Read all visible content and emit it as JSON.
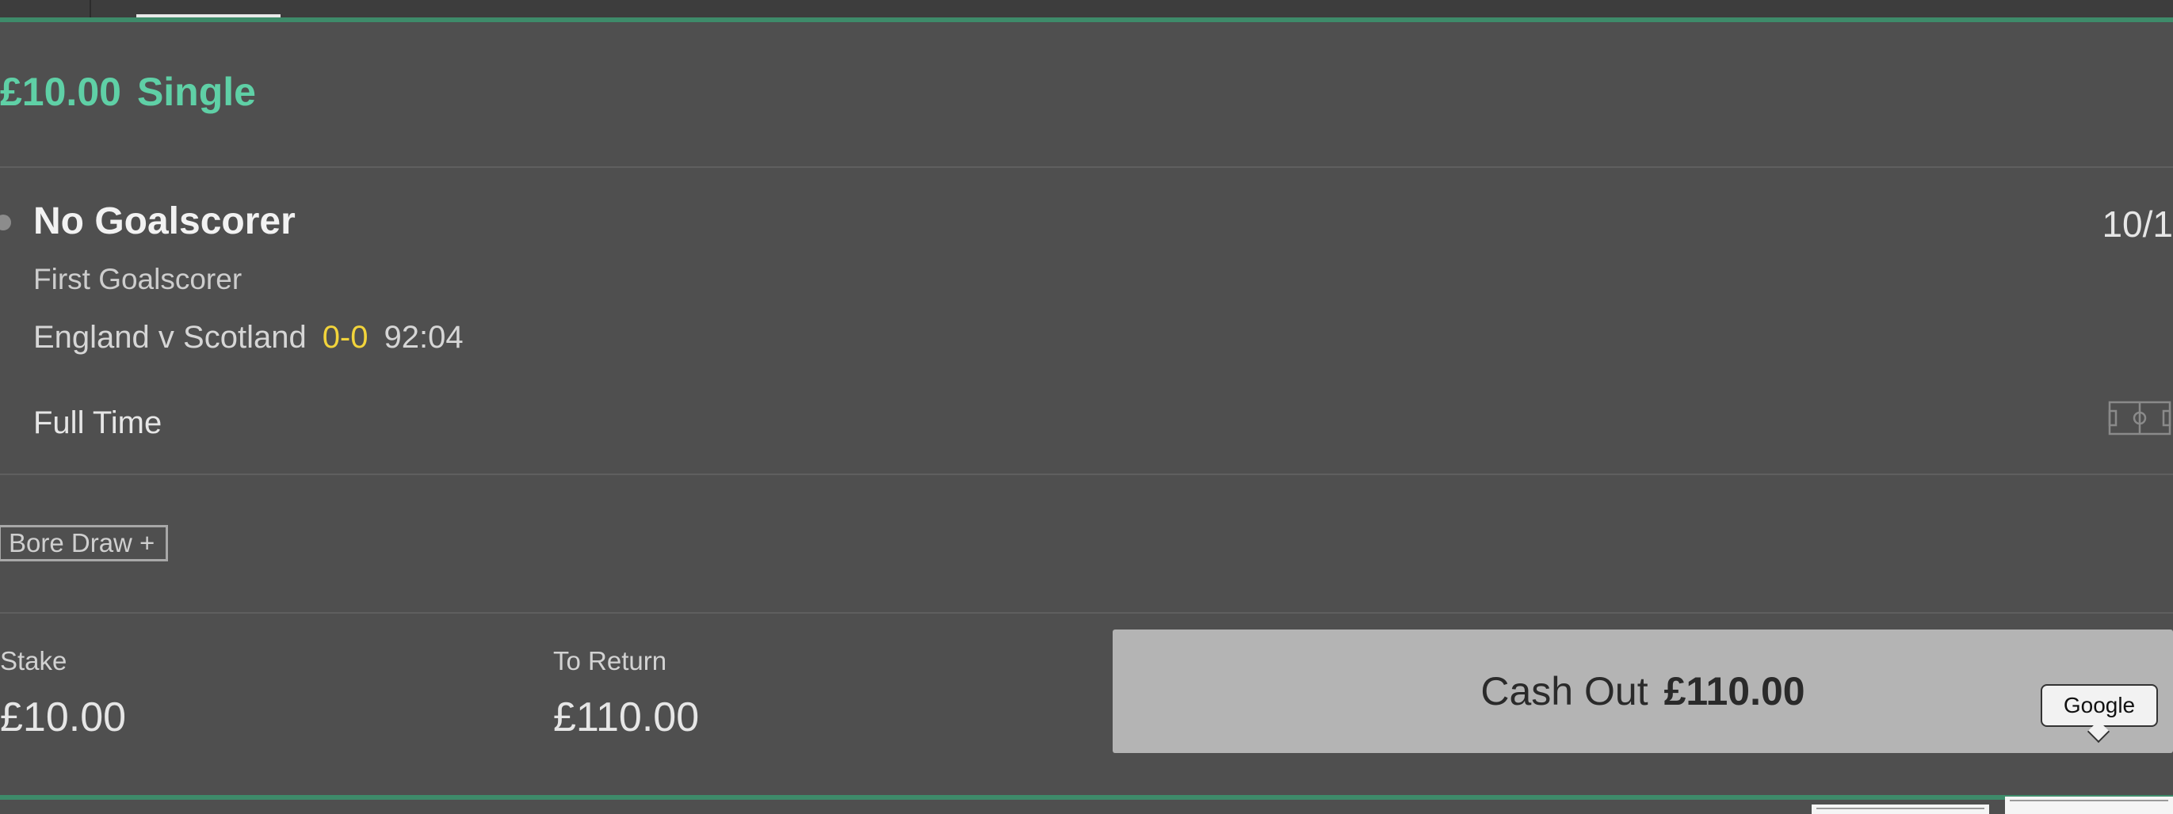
{
  "bet": {
    "stake_amount": "£10.00",
    "bet_type": "Single"
  },
  "selection": {
    "name": "No Goalscorer",
    "odds": "10/1",
    "market": "First Goalscorer",
    "event": "England v Scotland",
    "score": "0-0",
    "clock": "92:04",
    "status": "Full Time",
    "status_icon": "football-pitch-icon"
  },
  "tag": {
    "label": "Bore Draw +"
  },
  "summary": {
    "stake_label": "Stake",
    "stake_value": "£10.00",
    "return_label": "To Return",
    "return_value": "£110.00"
  },
  "cashout": {
    "label": "Cash Out",
    "amount": "£110.00"
  },
  "tooltip": {
    "text": "Google"
  },
  "colors": {
    "background": "#4f4f4f",
    "accent_green": "#5fd0a6",
    "score_yellow": "#f2d43b",
    "cashout_button": "#b4b4b4",
    "divider_green": "#3e8b6a"
  }
}
